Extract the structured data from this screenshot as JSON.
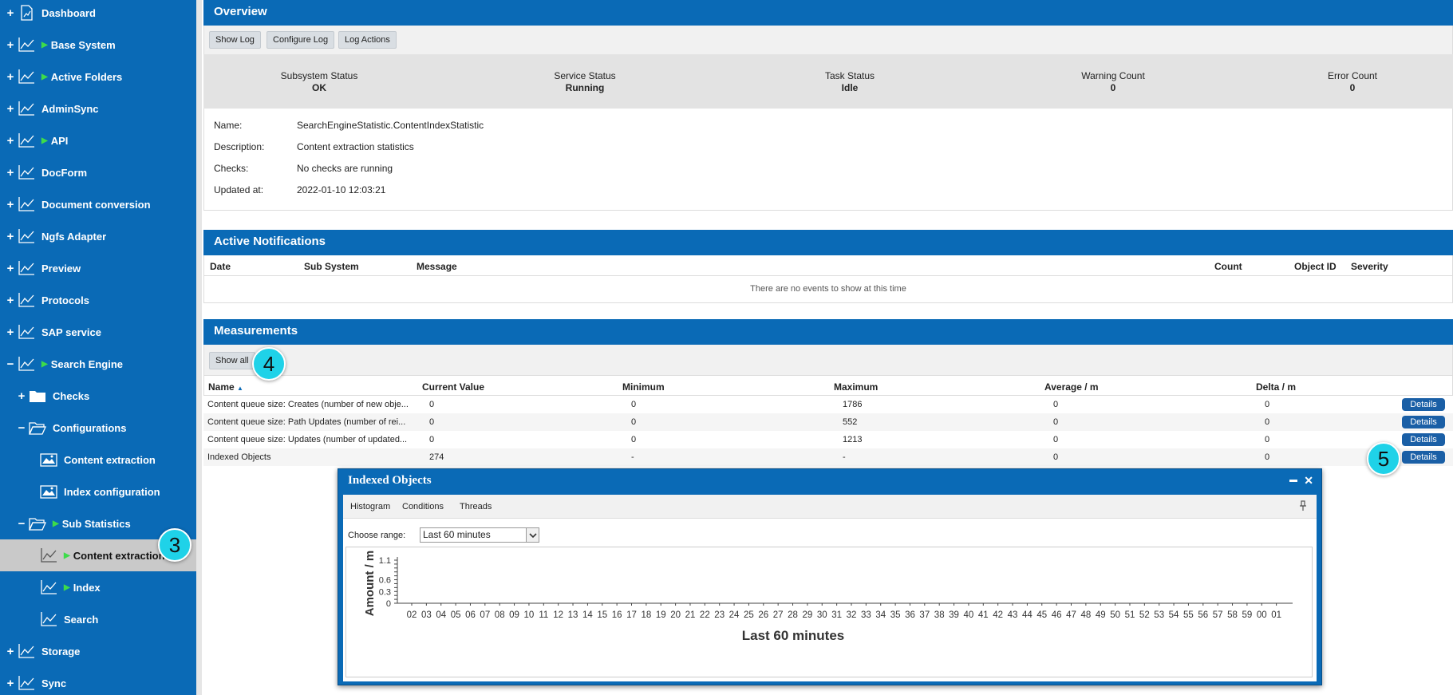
{
  "sidebar": {
    "items": [
      {
        "label": "Dashboard",
        "toggle": "+",
        "icon": "dashboard-icon"
      },
      {
        "label": "Base System",
        "toggle": "+",
        "icon": "chart-line-icon",
        "running": true
      },
      {
        "label": "Active Folders",
        "toggle": "+",
        "icon": "chart-line-icon",
        "running": true
      },
      {
        "label": "AdminSync",
        "toggle": "+",
        "icon": "chart-line-icon"
      },
      {
        "label": "API",
        "toggle": "+",
        "icon": "chart-line-icon",
        "running": true
      },
      {
        "label": "DocForm",
        "toggle": "+",
        "icon": "chart-line-icon"
      },
      {
        "label": "Document conversion",
        "toggle": "+",
        "icon": "chart-line-icon"
      },
      {
        "label": "Ngfs Adapter",
        "toggle": "+",
        "icon": "chart-line-icon"
      },
      {
        "label": "Preview",
        "toggle": "+",
        "icon": "chart-line-icon"
      },
      {
        "label": "Protocols",
        "toggle": "+",
        "icon": "chart-line-icon"
      },
      {
        "label": "SAP service",
        "toggle": "+",
        "icon": "chart-line-icon"
      },
      {
        "label": "Search Engine",
        "toggle": "−",
        "icon": "chart-line-icon",
        "running": true
      },
      {
        "label": "Checks",
        "toggle": "+",
        "icon": "folder-icon"
      },
      {
        "label": "Configurations",
        "toggle": "−",
        "icon": "folder-open-icon"
      },
      {
        "label": "Content extraction",
        "toggle": "",
        "icon": "config-image-icon"
      },
      {
        "label": "Index configuration",
        "toggle": "",
        "icon": "config-image-icon"
      },
      {
        "label": "Sub Statistics",
        "toggle": "−",
        "icon": "folder-open-icon",
        "running": true
      },
      {
        "label": "Content extraction",
        "toggle": "",
        "icon": "chart-line-icon",
        "running": true,
        "selected": true
      },
      {
        "label": "Index",
        "toggle": "",
        "icon": "chart-line-icon",
        "running": true
      },
      {
        "label": "Search",
        "toggle": "",
        "icon": "chart-line-icon"
      },
      {
        "label": "Storage",
        "toggle": "+",
        "icon": "chart-line-icon"
      },
      {
        "label": "Sync",
        "toggle": "+",
        "icon": "chart-line-icon"
      }
    ]
  },
  "overview": {
    "title": "Overview",
    "buttons": [
      "Show Log",
      "Configure Log",
      "Log Actions"
    ],
    "status": [
      {
        "label": "Subsystem Status",
        "value": "OK"
      },
      {
        "label": "Service Status",
        "value": "Running"
      },
      {
        "label": "Task Status",
        "value": "Idle"
      },
      {
        "label": "Warning Count",
        "value": "0"
      },
      {
        "label": "Error Count",
        "value": "0"
      }
    ],
    "info": [
      {
        "key": "Name:",
        "value": "SearchEngineStatistic.ContentIndexStatistic"
      },
      {
        "key": "Description:",
        "value": "Content extraction statistics"
      },
      {
        "key": "Checks:",
        "value": "No checks are running"
      },
      {
        "key": "Updated at:",
        "value": "2022-01-10 12:03:21"
      }
    ]
  },
  "notifications": {
    "title": "Active Notifications",
    "columns": [
      "Date",
      "Sub System",
      "Message",
      "Count",
      "Object ID",
      "Severity"
    ],
    "empty": "There are no events to show at this time"
  },
  "measurements": {
    "title": "Measurements",
    "show_all": "Show all",
    "columns": [
      "Name",
      "Current Value",
      "Minimum",
      "Maximum",
      "Average / m",
      "Delta / m"
    ],
    "sort_indicator": "▲",
    "rows": [
      {
        "name": "Content queue size: Creates (number of new obje...",
        "current": "0",
        "min": "0",
        "max": "1786",
        "avg": "0",
        "delta": "0",
        "details": "Details"
      },
      {
        "name": "Content queue size: Path Updates (number of rei...",
        "current": "0",
        "min": "0",
        "max": "552",
        "avg": "0",
        "delta": "0",
        "details": "Details"
      },
      {
        "name": "Content queue size: Updates (number of updated...",
        "current": "0",
        "min": "0",
        "max": "1213",
        "avg": "0",
        "delta": "0",
        "details": "Details"
      },
      {
        "name": "Indexed Objects",
        "current": "274",
        "min": "-",
        "max": "-",
        "avg": "0",
        "delta": "0",
        "details": "Details"
      }
    ]
  },
  "badges": {
    "b3": "3",
    "b4": "4",
    "b5": "5"
  },
  "popup": {
    "title": "Indexed Objects",
    "maximize": "▬",
    "close": "✕",
    "tabs": [
      "Histogram",
      "Conditions",
      "Threads"
    ],
    "range_label": "Choose range:",
    "range_value": "Last 60 minutes"
  },
  "chart_data": {
    "type": "bar",
    "title": "Last 60 minutes",
    "xlabel": "Last 60 minutes",
    "ylabel": "Amount / m",
    "ylim": [
      0,
      1.1
    ],
    "yticks": [
      "1.1",
      "0.6",
      "0.3",
      "0"
    ],
    "categories": [
      "02",
      "03",
      "04",
      "05",
      "06",
      "07",
      "08",
      "09",
      "10",
      "11",
      "12",
      "13",
      "14",
      "15",
      "16",
      "17",
      "18",
      "19",
      "20",
      "21",
      "22",
      "23",
      "24",
      "25",
      "26",
      "27",
      "28",
      "29",
      "30",
      "31",
      "32",
      "33",
      "34",
      "35",
      "36",
      "37",
      "38",
      "39",
      "40",
      "41",
      "42",
      "43",
      "44",
      "45",
      "46",
      "47",
      "48",
      "49",
      "50",
      "51",
      "52",
      "53",
      "54",
      "55",
      "56",
      "57",
      "58",
      "59",
      "00",
      "01"
    ],
    "values": [
      0,
      0,
      0,
      0,
      0,
      0,
      0,
      0,
      0,
      0,
      0,
      0,
      0,
      0,
      0,
      0,
      0,
      0,
      0,
      0,
      0,
      0,
      0,
      0,
      0,
      0,
      0,
      0,
      0,
      0,
      0,
      0,
      0,
      0,
      0,
      0,
      0,
      0,
      0,
      0,
      0,
      0,
      0,
      0,
      0,
      0,
      0,
      0,
      0,
      0,
      0,
      0,
      0,
      0,
      0,
      0,
      0,
      0,
      0,
      0
    ]
  },
  "colors": {
    "primary": "#0a6ab6",
    "running": "#3ddc4a",
    "badge": "#1fd2e8",
    "details": "#1a5fa6"
  }
}
